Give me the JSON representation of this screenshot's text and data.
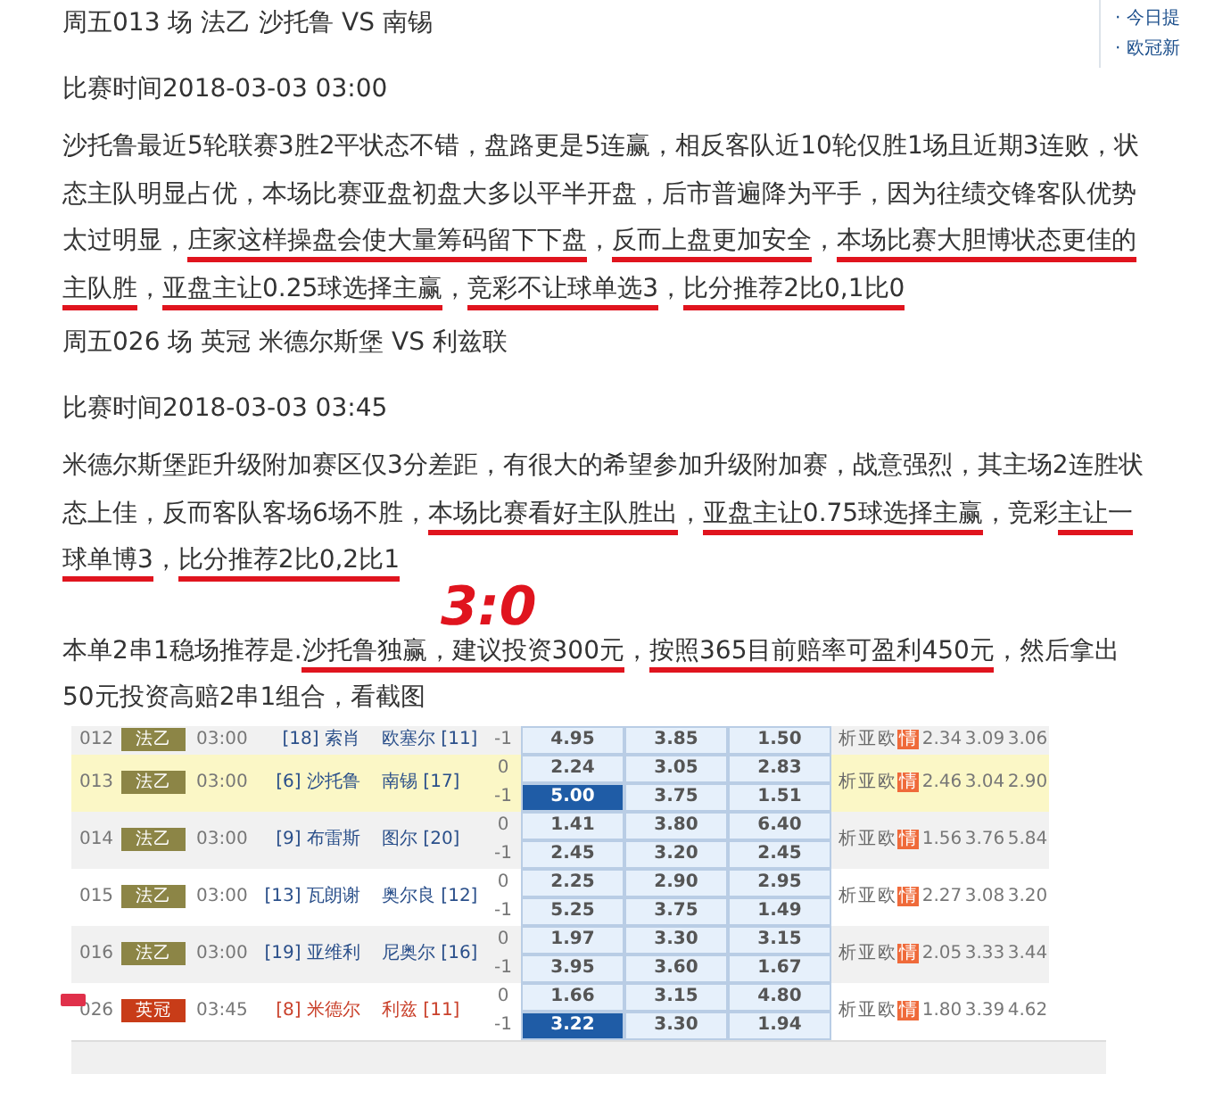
{
  "sidebar": {
    "links": [
      "· 今日提",
      "· 欧冠新"
    ]
  },
  "matches": [
    {
      "heading": "周五013 场 法乙 沙托鲁 VS 南锡",
      "time": "比赛时间2018-03-03 03:00",
      "analysis": [
        {
          "text": "沙托鲁最近5轮联赛3胜2平状态不错，盘路更是5连赢，相反客队近10轮仅胜1场且近期3连败，状态主队明显占优，本场比赛亚盘初盘大多以平半开盘，后市普遍降为平手，因为往绩交锋客队优势太过明显，",
          "underlined": false
        },
        {
          "text": "庄家这样操盘会使大量筹码留下下盘",
          "underlined": true
        },
        {
          "text": "，",
          "underlined": false
        },
        {
          "text": "反而上盘更加安全",
          "underlined": true
        },
        {
          "text": "，",
          "underlined": false
        },
        {
          "text": "本场比赛大胆博状态更佳的主队胜",
          "underlined": true
        },
        {
          "text": "，",
          "underlined": false
        },
        {
          "text": "亚盘主让0.25球选择主赢",
          "underlined": true
        },
        {
          "text": "，",
          "underlined": false
        },
        {
          "text": "竞彩不让球单选3",
          "underlined": true
        },
        {
          "text": "，",
          "underlined": false
        },
        {
          "text": "比分推荐2比0,1比0",
          "underlined": true
        }
      ]
    },
    {
      "heading": "周五026 场 英冠 米德尔斯堡 VS 利兹联",
      "time": "比赛时间2018-03-03 03:45",
      "analysis": [
        {
          "text": "米德尔斯堡距升级附加赛区仅3分差距，有很大的希望参加升级附加赛，战意强烈，其主场2连胜状态上佳，反而客队客场6场不胜，",
          "underlined": false
        },
        {
          "text": "本场比赛看好主队胜出",
          "underlined": true
        },
        {
          "text": "，",
          "underlined": false
        },
        {
          "text": "亚盘主让0.75球选择主赢",
          "underlined": true
        },
        {
          "text": "，竞彩",
          "underlined": false
        },
        {
          "text": "主让一球单博3",
          "underlined": true
        },
        {
          "text": "，",
          "underlined": false
        },
        {
          "text": "比分推荐2比0,2比1",
          "underlined": true
        }
      ]
    }
  ],
  "annotation": "3:0",
  "summary": [
    {
      "text": "本单2串1稳场推荐是.",
      "underlined": false
    },
    {
      "text": "沙托鲁独赢，建议投资300元",
      "underlined": true
    },
    {
      "text": "，",
      "underlined": false
    },
    {
      "text": "按照365目前赔率可盈利450元",
      "underlined": true
    },
    {
      "text": "，然后拿出50元投资高赔2串1组合，看截图",
      "underlined": false
    }
  ],
  "table": {
    "rows": [
      {
        "id": "012",
        "league": "法乙",
        "color": "#8c8546",
        "time": "03:00",
        "home": "[18] 索肖",
        "away": "欧塞尔 [11]",
        "highlighted": false,
        "tagged": false,
        "lines": [
          {
            "handicap": "-1",
            "odds": [
              {
                "value": "4.95",
                "selected": false
              },
              {
                "value": "3.85",
                "selected": false
              },
              {
                "value": "1.50",
                "selected": false
              }
            ]
          }
        ],
        "links": [
          {
            "text": "析",
            "hot": false
          },
          {
            "text": "亚",
            "hot": false
          },
          {
            "text": "欧",
            "hot": false
          },
          {
            "text": "情",
            "hot": true
          }
        ],
        "avg": [
          "2.34",
          "3.09",
          "3.06"
        ]
      },
      {
        "id": "013",
        "league": "法乙",
        "color": "#8c8546",
        "time": "03:00",
        "home": "[6] 沙托鲁",
        "away": "南锡 [17]",
        "highlighted": true,
        "tagged": false,
        "lines": [
          {
            "handicap": "0",
            "odds": [
              {
                "value": "2.24",
                "selected": false
              },
              {
                "value": "3.05",
                "selected": false
              },
              {
                "value": "2.83",
                "selected": false
              }
            ]
          },
          {
            "handicap": "-1",
            "odds": [
              {
                "value": "5.00",
                "selected": true
              },
              {
                "value": "3.75",
                "selected": false
              },
              {
                "value": "1.51",
                "selected": false
              }
            ]
          }
        ],
        "links": [
          {
            "text": "析",
            "hot": false
          },
          {
            "text": "亚",
            "hot": false
          },
          {
            "text": "欧",
            "hot": false
          },
          {
            "text": "情",
            "hot": true
          }
        ],
        "avg": [
          "2.46",
          "3.04",
          "2.90"
        ]
      },
      {
        "id": "014",
        "league": "法乙",
        "color": "#8c8546",
        "time": "03:00",
        "home": "[9] 布雷斯",
        "away": "图尔 [20]",
        "highlighted": false,
        "tagged": false,
        "lines": [
          {
            "handicap": "0",
            "odds": [
              {
                "value": "1.41",
                "selected": false
              },
              {
                "value": "3.80",
                "selected": false
              },
              {
                "value": "6.40",
                "selected": false
              }
            ]
          },
          {
            "handicap": "-1",
            "odds": [
              {
                "value": "2.45",
                "selected": false
              },
              {
                "value": "3.20",
                "selected": false
              },
              {
                "value": "2.45",
                "selected": false
              }
            ]
          }
        ],
        "links": [
          {
            "text": "析",
            "hot": false
          },
          {
            "text": "亚",
            "hot": false
          },
          {
            "text": "欧",
            "hot": false
          },
          {
            "text": "情",
            "hot": true
          }
        ],
        "avg": [
          "1.56",
          "3.76",
          "5.84"
        ]
      },
      {
        "id": "015",
        "league": "法乙",
        "color": "#8c8546",
        "time": "03:00",
        "home": "[13] 瓦朗谢",
        "away": "奥尔良 [12]",
        "highlighted": false,
        "tagged": false,
        "lines": [
          {
            "handicap": "0",
            "odds": [
              {
                "value": "2.25",
                "selected": false
              },
              {
                "value": "2.90",
                "selected": false
              },
              {
                "value": "2.95",
                "selected": false
              }
            ]
          },
          {
            "handicap": "-1",
            "odds": [
              {
                "value": "5.25",
                "selected": false
              },
              {
                "value": "3.75",
                "selected": false
              },
              {
                "value": "1.49",
                "selected": false
              }
            ]
          }
        ],
        "links": [
          {
            "text": "析",
            "hot": false
          },
          {
            "text": "亚",
            "hot": false
          },
          {
            "text": "欧",
            "hot": false
          },
          {
            "text": "情",
            "hot": true
          }
        ],
        "avg": [
          "2.27",
          "3.08",
          "3.20"
        ]
      },
      {
        "id": "016",
        "league": "法乙",
        "color": "#8c8546",
        "time": "03:00",
        "home": "[19] 亚维利",
        "away": "尼奥尔 [16]",
        "highlighted": false,
        "tagged": false,
        "lines": [
          {
            "handicap": "0",
            "odds": [
              {
                "value": "1.97",
                "selected": false
              },
              {
                "value": "3.30",
                "selected": false
              },
              {
                "value": "3.15",
                "selected": false
              }
            ]
          },
          {
            "handicap": "-1",
            "odds": [
              {
                "value": "3.95",
                "selected": false
              },
              {
                "value": "3.60",
                "selected": false
              },
              {
                "value": "1.67",
                "selected": false
              }
            ]
          }
        ],
        "links": [
          {
            "text": "析",
            "hot": false
          },
          {
            "text": "亚",
            "hot": false
          },
          {
            "text": "欧",
            "hot": false
          },
          {
            "text": "情",
            "hot": true
          }
        ],
        "avg": [
          "2.05",
          "3.33",
          "3.44"
        ]
      },
      {
        "id": "026",
        "league": "英冠",
        "color": "#c83c18",
        "time": "03:45",
        "home": "[8] 米德尔",
        "away": "利兹 [11]",
        "highlighted": false,
        "tagged": true,
        "lines": [
          {
            "handicap": "0",
            "odds": [
              {
                "value": "1.66",
                "selected": false
              },
              {
                "value": "3.15",
                "selected": false
              },
              {
                "value": "4.80",
                "selected": false
              }
            ]
          },
          {
            "handicap": "-1",
            "odds": [
              {
                "value": "3.22",
                "selected": true
              },
              {
                "value": "3.30",
                "selected": false
              },
              {
                "value": "1.94",
                "selected": false
              }
            ]
          }
        ],
        "links": [
          {
            "text": "析",
            "hot": false
          },
          {
            "text": "亚",
            "hot": false
          },
          {
            "text": "欧",
            "hot": false
          },
          {
            "text": "情",
            "hot": true
          }
        ],
        "avg": [
          "1.80",
          "3.39",
          "4.62"
        ]
      }
    ]
  }
}
